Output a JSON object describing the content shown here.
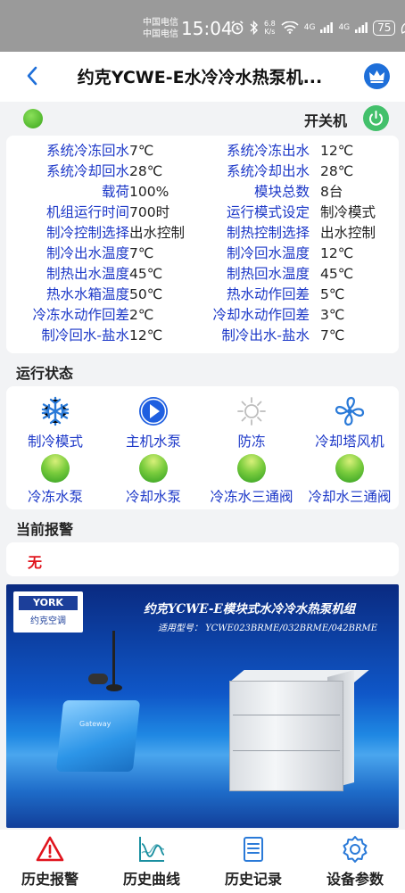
{
  "status_bar": {
    "carrier_1": "中国电信",
    "carrier_2": "中国电信",
    "time": "15:04",
    "net_speed_value": "6.8",
    "net_speed_unit": "K/s",
    "signal_1": "4G",
    "signal_2": "4G",
    "battery": "75"
  },
  "header": {
    "title": "约克YCWE-E水冷冷水热泵机...",
    "back_icon": "chevron-left-icon",
    "crown_icon": "crown-icon",
    "accent_color": "#1e6fd9"
  },
  "power": {
    "label": "开关机",
    "state_color": "#43c06b"
  },
  "params": [
    {
      "l1": "系统冷冻回水",
      "v1": "7℃",
      "l2": "系统冷冻出水",
      "v2": "12℃"
    },
    {
      "l1": "系统冷却回水",
      "v1": "28℃",
      "l2": "系统冷却出水",
      "v2": "28℃"
    },
    {
      "l1": "载荷",
      "v1": "100%",
      "l2": "模块总数",
      "v2": "8台"
    },
    {
      "l1": "机组运行时间",
      "v1": "700时",
      "l2": "运行模式设定",
      "v2": "制冷模式"
    },
    {
      "l1": "制冷控制选择",
      "v1": "出水控制",
      "l2": "制热控制选择",
      "v2": "出水控制"
    },
    {
      "l1": "制冷出水温度",
      "v1": "7℃",
      "l2": "制冷回水温度",
      "v2": "12℃"
    },
    {
      "l1": "制热出水温度",
      "v1": "45℃",
      "l2": "制热回水温度",
      "v2": "45℃"
    },
    {
      "l1": "热水水箱温度",
      "v1": "50℃",
      "l2": "热水动作回差",
      "v2": "5℃"
    },
    {
      "l1": "冷冻水动作回差",
      "v1": "2℃",
      "l2": "冷却水动作回差",
      "v2": "3℃"
    },
    {
      "l1": "制冷回水-盐水",
      "v1": "12℃",
      "l2": "制冷出水-盐水",
      "v2": "7℃"
    }
  ],
  "run_status": {
    "title": "运行状态",
    "modes": [
      {
        "label": "制冷模式",
        "icon": "snowflake-icon"
      },
      {
        "label": "主机水泵",
        "icon": "play-circle-icon"
      },
      {
        "label": "防冻",
        "icon": "sun-icon"
      },
      {
        "label": "冷却塔风机",
        "icon": "fan-icon"
      }
    ],
    "indicators": [
      {
        "label": "冷冻水泵"
      },
      {
        "label": "冷却水泵"
      },
      {
        "label": "冷冻水三通阀"
      },
      {
        "label": "冷却水三通阀"
      }
    ]
  },
  "alarm": {
    "title": "当前报警",
    "value": "无"
  },
  "banner": {
    "logo_text": "YORK",
    "logo_sub": "约克空调",
    "title": "约克YCWE-E模块式水冷冷水热泵机组",
    "model": "适用型号： YCWE023BRME/032BRME/042BRME",
    "gateway_label": "Gateway"
  },
  "bottom_nav": [
    {
      "label": "历史报警",
      "icon": "warning-icon"
    },
    {
      "label": "历史曲线",
      "icon": "chart-curve-icon"
    },
    {
      "label": "历史记录",
      "icon": "document-list-icon"
    },
    {
      "label": "设备参数",
      "icon": "gear-icon"
    }
  ]
}
